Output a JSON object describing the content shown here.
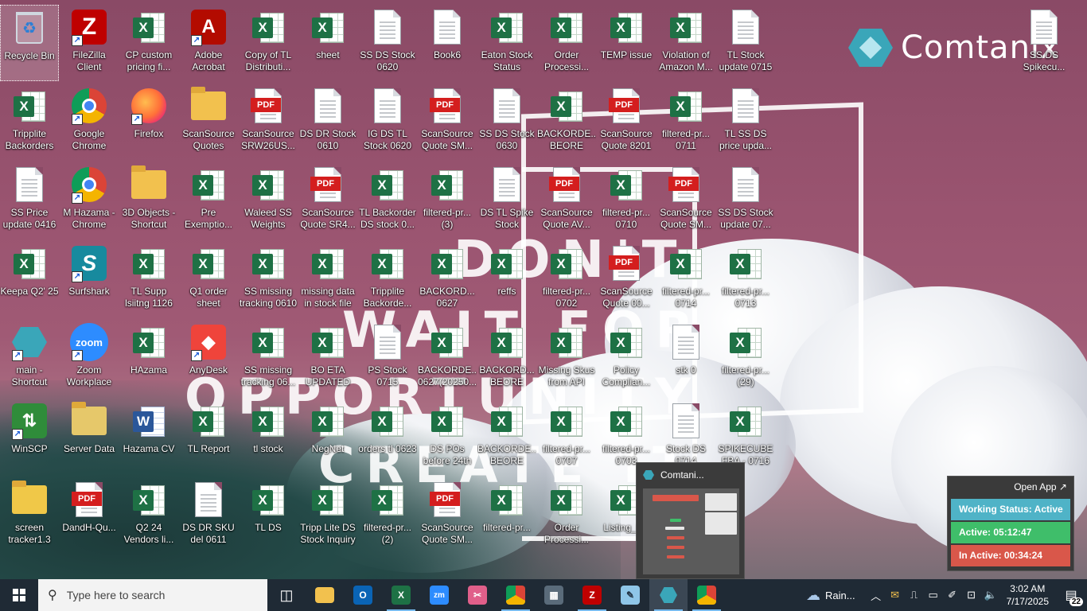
{
  "wallpaper": {
    "brand_name": "Comtanix",
    "quote_lines": [
      "DON'T",
      "WAIT FOR",
      "OPPORTUNITY",
      "CREATE IT"
    ]
  },
  "desktop": {
    "icons": [
      {
        "label": "Recycle Bin",
        "kind": "recycle"
      },
      {
        "label": "FileZilla Client",
        "kind": "filezilla"
      },
      {
        "label": "CP custom pricing fi...",
        "kind": "excel"
      },
      {
        "label": "Adobe Acrobat",
        "kind": "acrobat"
      },
      {
        "label": "Copy of TL Distributi...",
        "kind": "excel"
      },
      {
        "label": "sheet",
        "kind": "excel"
      },
      {
        "label": "SS DS Stock 0620",
        "kind": "doc"
      },
      {
        "label": "Book6",
        "kind": "doc"
      },
      {
        "label": "Eaton Stock Status",
        "kind": "excel"
      },
      {
        "label": "Order Processi...",
        "kind": "excel"
      },
      {
        "label": "TEMP issue",
        "kind": "excel"
      },
      {
        "label": "Violation of Amazon M...",
        "kind": "excel"
      },
      {
        "label": "TL Stock update 0715",
        "kind": "doc"
      },
      {
        "label": "SS DS Spikecu...",
        "kind": "doc"
      },
      {
        "label": "Tripplite Backorders",
        "kind": "excel"
      },
      {
        "label": "Google Chrome",
        "kind": "chrome"
      },
      {
        "label": "Firefox",
        "kind": "firefox"
      },
      {
        "label": "ScanSource Quotes",
        "kind": "folder"
      },
      {
        "label": "ScanSource SRW26US...",
        "kind": "pdf"
      },
      {
        "label": "DS DR Stock 0610",
        "kind": "doc"
      },
      {
        "label": "IG DS TL Stock 0620",
        "kind": "doc"
      },
      {
        "label": "ScanSource Quote SM...",
        "kind": "pdf"
      },
      {
        "label": "SS DS Stock 0630",
        "kind": "doc"
      },
      {
        "label": "BACKORDE... BEORE 23R...",
        "kind": "excel"
      },
      {
        "label": "ScanSource Quote 8201",
        "kind": "pdf"
      },
      {
        "label": "filtered-pr... 0711",
        "kind": "excel"
      },
      {
        "label": "TL SS DS price upda...",
        "kind": "doc"
      },
      {
        "label": "SS Price update 0416",
        "kind": "doc"
      },
      {
        "label": "M Hazama - Chrome",
        "kind": "chrome"
      },
      {
        "label": "3D Objects - Shortcut",
        "kind": "folder"
      },
      {
        "label": "Pre Exemptio...",
        "kind": "excel"
      },
      {
        "label": "Waleed SS Weights",
        "kind": "excel"
      },
      {
        "label": "ScanSource Quote SR4...",
        "kind": "pdf"
      },
      {
        "label": "TL Backorder DS stock 0...",
        "kind": "excel"
      },
      {
        "label": "filtered-pr... (3)",
        "kind": "excel"
      },
      {
        "label": "DS TL Spike Stock",
        "kind": "doc"
      },
      {
        "label": "ScanSource Quote AV...",
        "kind": "pdf"
      },
      {
        "label": "filtered-pr... 0710",
        "kind": "excel"
      },
      {
        "label": "ScanSource Quote SM...",
        "kind": "pdf"
      },
      {
        "label": "SS DS Stock update 07...",
        "kind": "doc"
      },
      {
        "label": "Keepa Q2' 25",
        "kind": "excel"
      },
      {
        "label": "Surfshark",
        "kind": "surfshark"
      },
      {
        "label": "TL Supp lsiitng 1126",
        "kind": "excel"
      },
      {
        "label": "Q1 order sheet",
        "kind": "excel"
      },
      {
        "label": "SS missing tracking 0610",
        "kind": "excel"
      },
      {
        "label": "missing data in stock file",
        "kind": "excel"
      },
      {
        "label": "Tripplite Backorde...",
        "kind": "excel"
      },
      {
        "label": "BACKORD... 0627",
        "kind": "excel"
      },
      {
        "label": "reffs",
        "kind": "excel"
      },
      {
        "label": "filtered-pr... 0702",
        "kind": "excel"
      },
      {
        "label": "ScanSource Quote 00...",
        "kind": "pdf"
      },
      {
        "label": "filtered-pr... 0714",
        "kind": "excel"
      },
      {
        "label": "filtered-pr... 0713",
        "kind": "excel"
      },
      {
        "label": "main - Shortcut",
        "kind": "comtanix"
      },
      {
        "label": "Zoom Workplace",
        "kind": "zoom"
      },
      {
        "label": "HAzama",
        "kind": "excel"
      },
      {
        "label": "AnyDesk",
        "kind": "anydesk"
      },
      {
        "label": "SS missing tracking 06...",
        "kind": "excel"
      },
      {
        "label": "BO ETA UPDATED",
        "kind": "excel"
      },
      {
        "label": "PS Stock 0715",
        "kind": "doc"
      },
      {
        "label": "BACKORDE... 0627(20250...",
        "kind": "excel"
      },
      {
        "label": "BACKORD... BEORE 23R...",
        "kind": "excel"
      },
      {
        "label": "Missing Skus from API",
        "kind": "excel"
      },
      {
        "label": "Policy Complian...",
        "kind": "excel"
      },
      {
        "label": "stk 0",
        "kind": "doc"
      },
      {
        "label": "filtered-pr... (29)",
        "kind": "excel"
      },
      {
        "label": "WinSCP",
        "kind": "winscp"
      },
      {
        "label": "Server Data",
        "kind": "serverdata"
      },
      {
        "label": "Hazama CV",
        "kind": "word"
      },
      {
        "label": "TL Report",
        "kind": "excel"
      },
      {
        "label": "tl stock",
        "kind": "excel"
      },
      {
        "label": "NegNet",
        "kind": "excel"
      },
      {
        "label": "orders tl 0623",
        "kind": "excel"
      },
      {
        "label": "DS POs before 24th",
        "kind": "excel"
      },
      {
        "label": "BACKORDE... BEORE 23R...",
        "kind": "excel"
      },
      {
        "label": "filtered-pr... 0707",
        "kind": "excel"
      },
      {
        "label": "filtered-pr... 0703",
        "kind": "excel"
      },
      {
        "label": "Stock DS 0714",
        "kind": "doc"
      },
      {
        "label": "SPIKECUBE FBA - 0716",
        "kind": "excel"
      },
      {
        "label": "screen tracker1.3",
        "kind": "zip"
      },
      {
        "label": "DandH-Qu...",
        "kind": "pdf"
      },
      {
        "label": "Q2 24 Vendors li...",
        "kind": "excel"
      },
      {
        "label": "DS DR SKU del 0611",
        "kind": "doc"
      },
      {
        "label": "TL DS",
        "kind": "excel"
      },
      {
        "label": "Tripp Lite DS Stock Inquiry",
        "kind": "excel"
      },
      {
        "label": "filtered-pr... (2)",
        "kind": "excel"
      },
      {
        "label": "ScanSource Quote SM...",
        "kind": "pdf"
      },
      {
        "label": "filtered-pr...",
        "kind": "excel"
      },
      {
        "label": "Order Processi...",
        "kind": "excel"
      },
      {
        "label": "Listing_F...",
        "kind": "excel"
      }
    ]
  },
  "preview": {
    "title": "Comtani..."
  },
  "status_widget": {
    "open_app": "Open App ↗",
    "working_status": "Working Status: Active",
    "active": "Active: 05:12:47",
    "inactive": "In Active: 00:34:24",
    "colors": {
      "working": "#4fb3c7",
      "active": "#3fbe6a",
      "inactive": "#d9574a"
    }
  },
  "taskbar": {
    "search_placeholder": "Type here to search",
    "weather": "Rain...",
    "time": "3:02 AM",
    "date": "7/17/2025",
    "notification_count": "22",
    "apps": [
      {
        "name": "task-view"
      },
      {
        "name": "file-explorer"
      },
      {
        "name": "outlook"
      },
      {
        "name": "excel"
      },
      {
        "name": "zoom"
      },
      {
        "name": "snipping"
      },
      {
        "name": "chrome-profile"
      },
      {
        "name": "calculator"
      },
      {
        "name": "filezilla"
      },
      {
        "name": "notepad"
      },
      {
        "name": "comtanix"
      },
      {
        "name": "chrome"
      }
    ]
  }
}
